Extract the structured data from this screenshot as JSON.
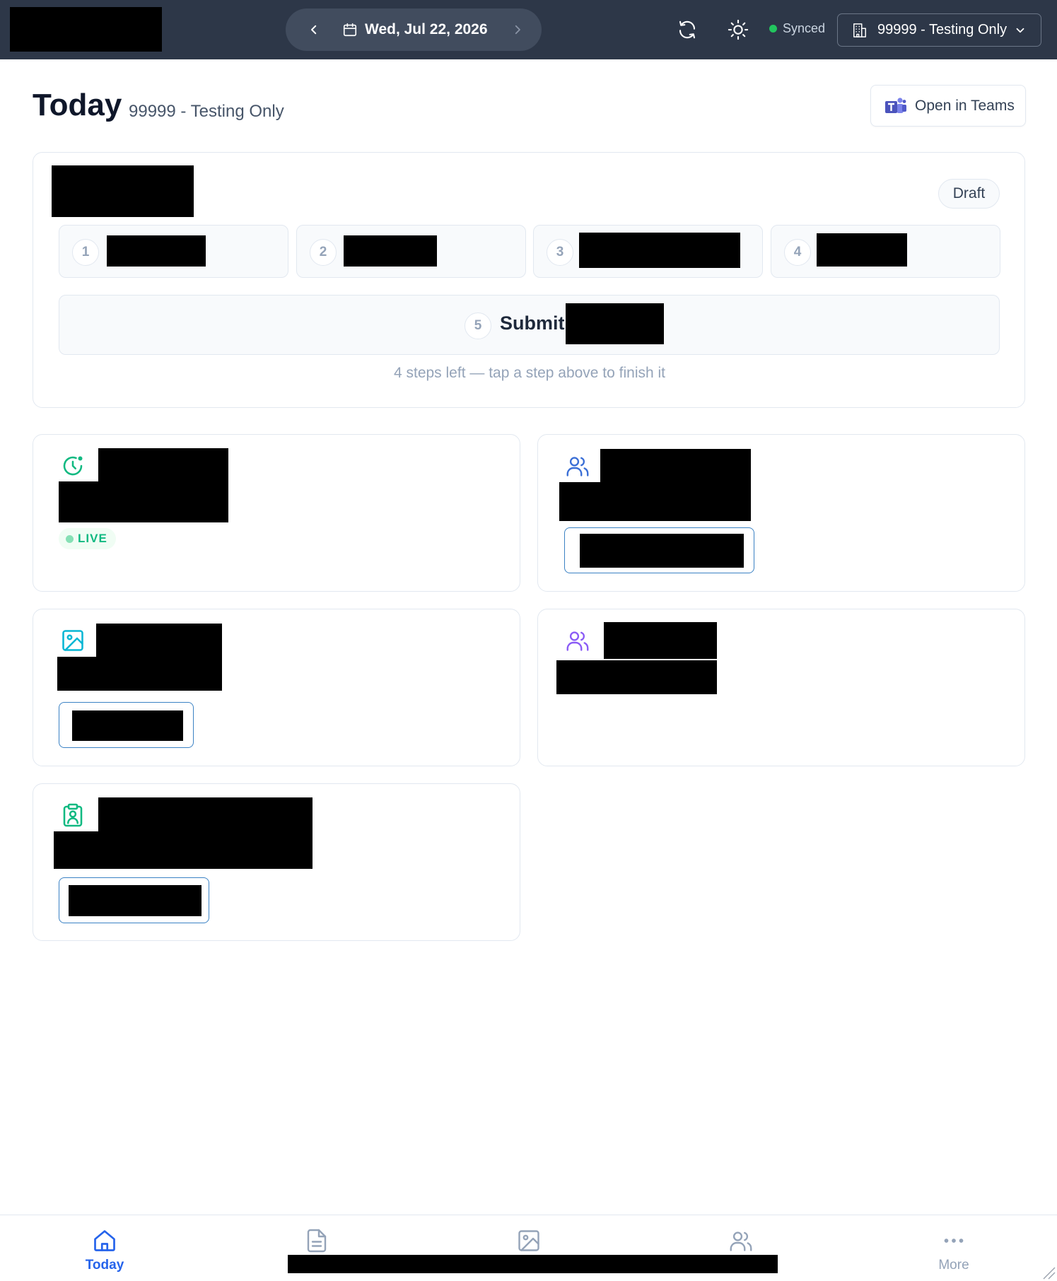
{
  "topbar": {
    "date": "Wed, Jul 22, 2026",
    "sync_status": "Synced",
    "site": "99999 - Testing Only",
    "icons": {
      "prev": "chevron-left-icon",
      "next": "chevron-right-icon",
      "calendar": "calendar-icon",
      "refresh": "refresh-icon",
      "theme": "sun-icon",
      "site": "building-icon",
      "dropdown": "chevron-down-icon"
    }
  },
  "header": {
    "title": "Today",
    "subtitle": "99999 - Testing Only",
    "teams_button": "Open in Teams"
  },
  "workflow": {
    "status_badge": "Draft",
    "steps": [
      {
        "number": "1"
      },
      {
        "number": "2"
      },
      {
        "number": "3"
      },
      {
        "number": "4"
      }
    ],
    "submit": {
      "number": "5",
      "label": "Submit"
    },
    "hint": "4 steps left — tap a step above to finish it"
  },
  "modules": {
    "live_badge": "LIVE"
  },
  "bottom_nav": {
    "items": [
      {
        "label": "Today",
        "icon": "home-icon",
        "active": true
      },
      {
        "label": "",
        "icon": "document-icon",
        "active": false
      },
      {
        "label": "",
        "icon": "image-icon",
        "active": false
      },
      {
        "label": "",
        "icon": "users-icon",
        "active": false
      },
      {
        "label": "More",
        "icon": "more-icon",
        "active": false
      }
    ]
  },
  "colors": {
    "topbar": "#2d3748",
    "accent": "#2563eb",
    "live": "#10b981",
    "synced": "#22c55e"
  }
}
